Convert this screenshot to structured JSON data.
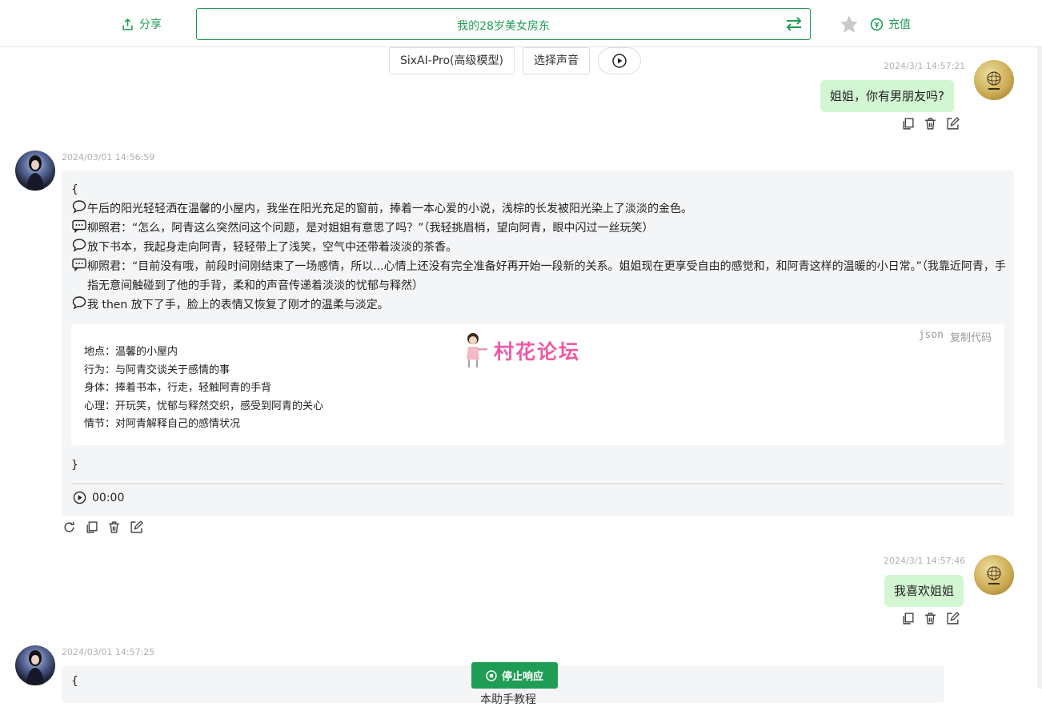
{
  "header": {
    "share_label": "分享",
    "title": "我的28岁美女房东",
    "recharge_label": "充值"
  },
  "toolbar": {
    "model_label": "SixAI-Pro(高级模型)",
    "voice_label": "选择声音"
  },
  "messages": {
    "user1": {
      "timestamp": "2024/3/1 14:57:21",
      "text": "姐姐，你有男朋友吗?"
    },
    "bot1": {
      "timestamp": "2024/03/01 14:56:59",
      "open_brace": "{",
      "lines": [
        {
          "icon": "speech-bubble-icon",
          "text": "午后的阳光轻轻洒在温馨的小屋内，我坐在阳光充足的窗前，捧着一本心爱的小说，浅棕的长发被阳光染上了淡淡的金色。"
        },
        {
          "icon": "dialog-icon",
          "text": "柳照君：“怎么，阿青这么突然问这个问题，是对姐姐有意思了吗？”（我轻挑眉梢，望向阿青，眼中闪过一丝玩笑）"
        },
        {
          "icon": "speech-bubble-icon",
          "text": "放下书本，我起身走向阿青，轻轻带上了浅笑，空气中还带着淡淡的茶香。"
        },
        {
          "icon": "dialog-icon",
          "text": "柳照君：“目前没有哦，前段时间刚结束了一场感情，所以...心情上还没有完全准备好再开始一段新的关系。姐姐现在更享受自由的感觉和，和阿青这样的温暖的小日常。”（我靠近阿青，手指无意间触碰到了他的手背，柔和的声音传递着淡淡的忧郁与释然）"
        },
        {
          "icon": "speech-bubble-icon",
          "text": "我 then 放下了手，脸上的表情又恢复了刚才的温柔与淡定。"
        }
      ],
      "code": {
        "lang": "json",
        "copy_label": "复制代码",
        "lines": [
          "地点：温馨的小屋内",
          "行为：与阿青交谈关于感情的事",
          "身体：捧着书本，行走，轻触阿青的手背",
          "心理：开玩笑，忧郁与释然交织，感受到阿青的关心",
          "情节：对阿青解释自己的感情状况"
        ]
      },
      "watermark": "村花论坛",
      "close_brace": "}",
      "audio_time": "00:00"
    },
    "user2": {
      "timestamp": "2024/3/1 14:57:46",
      "text": "我喜欢姐姐"
    },
    "bot2": {
      "timestamp": "2024/03/01 14:57:25",
      "open_brace": "{"
    }
  },
  "footer": {
    "stop_label": "停止响应",
    "tutorial_label": "本助手教程"
  },
  "colors": {
    "accent": "#1f9d55",
    "user_bubble": "#d2f5d2",
    "bot_panel": "#f4f5f7"
  }
}
